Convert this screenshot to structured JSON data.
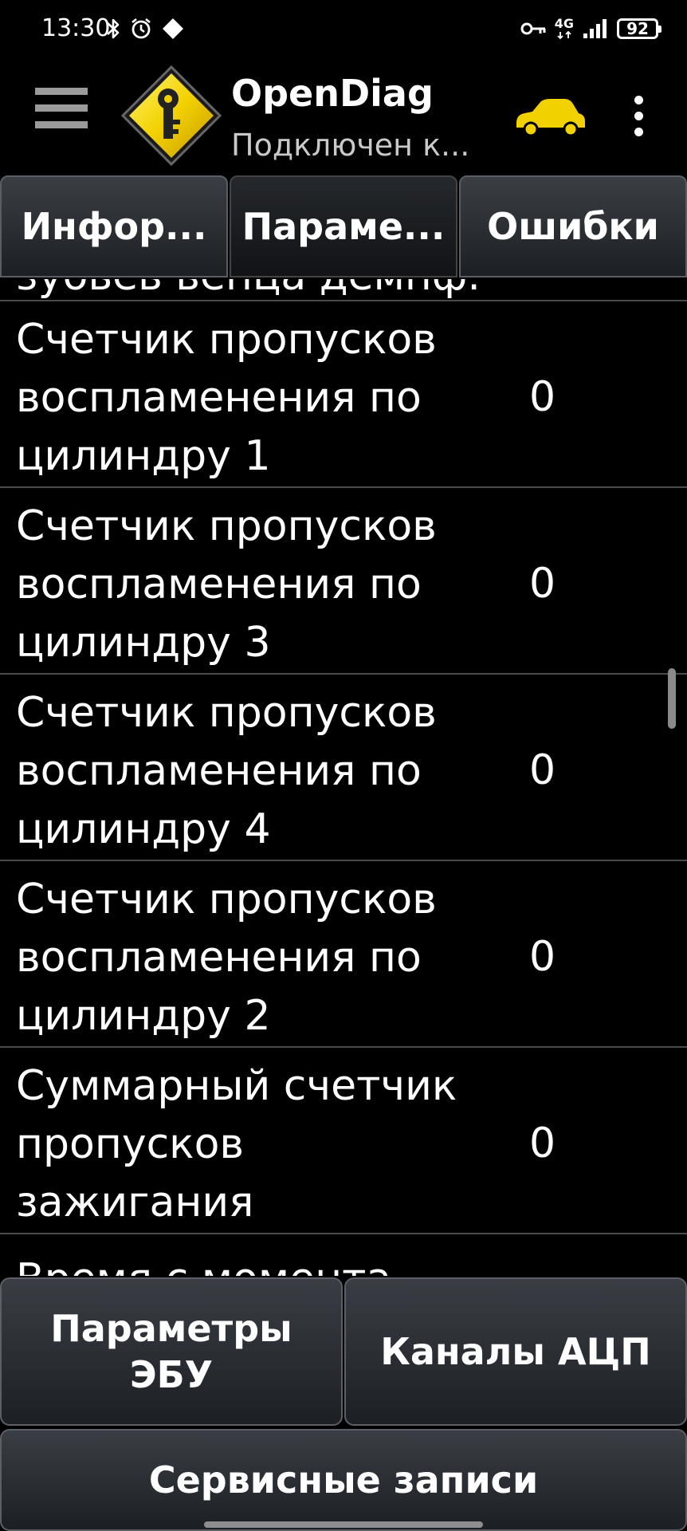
{
  "status_bar": {
    "time": "13:30",
    "network": "4G",
    "battery": "92",
    "icons_left": [
      "bluetooth-icon",
      "alarm-icon",
      "diamond-icon"
    ],
    "icons_right": [
      "vpn-key-icon",
      "signal-icon",
      "battery-icon"
    ]
  },
  "app_bar": {
    "title": "OpenDiag",
    "subtitle": "Подключен к...",
    "accent_color": "#f2d100"
  },
  "tabs": [
    {
      "label": "Инфор...",
      "active": false
    },
    {
      "label": "Параме...",
      "active": true
    },
    {
      "label": "Ошибки",
      "active": false
    }
  ],
  "list": {
    "partial_top": "зубьев венца демпф.",
    "rows": [
      {
        "label": "Счетчик пропусков воспламенения по цилиндру 1",
        "value": "0"
      },
      {
        "label": "Счетчик пропусков воспламенения по цилиндру 3",
        "value": "0"
      },
      {
        "label": "Счетчик пропусков воспламенения по цилиндру 4",
        "value": "0"
      },
      {
        "label": "Счетчик пропусков воспламенения по цилиндру 2",
        "value": "0"
      },
      {
        "label": "Суммарный счетчик пропусков зажигания",
        "value": "0"
      }
    ],
    "partial_bottom": "Время с момента"
  },
  "buttons": {
    "ecu_params": "Параметры ЭБУ",
    "adc_channels": "Каналы АЦП",
    "service_records": "Сервисные записи"
  }
}
